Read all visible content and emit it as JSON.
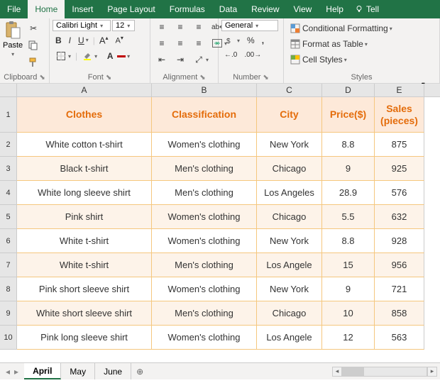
{
  "titlebar": {
    "tabs": [
      "File",
      "Home",
      "Insert",
      "Page Layout",
      "Formulas",
      "Data",
      "Review",
      "View",
      "Help"
    ],
    "active_tab": "Home",
    "tell": "Tell"
  },
  "ribbon": {
    "clipboard": {
      "paste": "Paste",
      "label": "Clipboard"
    },
    "font": {
      "name": "Calibri Light",
      "size": "12",
      "bold": "B",
      "italic": "I",
      "underline": "U",
      "label": "Font"
    },
    "alignment": {
      "wrap": "ab",
      "label": "Alignment"
    },
    "number": {
      "format": "General",
      "percent": "%",
      "comma": ",",
      "dec_inc": ".0",
      "dec_dec": ".00",
      "label": "Number"
    },
    "styles": {
      "cond": "Conditional Formatting",
      "table": "Format as Table",
      "cell": "Cell Styles",
      "label": "Styles"
    }
  },
  "columns": [
    "A",
    "B",
    "C",
    "D",
    "E"
  ],
  "headers": {
    "a": "Clothes",
    "b": "Classification",
    "c": "City",
    "d": "Price($)",
    "e": "Sales (pieces)"
  },
  "rows": [
    {
      "n": "2",
      "a": "White cotton t-shirt",
      "b": "Women's clothing",
      "c": "New York",
      "d": "8.8",
      "e": "875"
    },
    {
      "n": "3",
      "a": "Black t-shirt",
      "b": "Men's clothing",
      "c": "Chicago",
      "d": "9",
      "e": "925"
    },
    {
      "n": "4",
      "a": "White long sleeve shirt",
      "b": "Men's clothing",
      "c": "Los Angeles",
      "d": "28.9",
      "e": "576"
    },
    {
      "n": "5",
      "a": "Pink shirt",
      "b": "Women's clothing",
      "c": "Chicago",
      "d": "5.5",
      "e": "632"
    },
    {
      "n": "6",
      "a": "White t-shirt",
      "b": "Women's clothing",
      "c": "New York",
      "d": "8.8",
      "e": "928"
    },
    {
      "n": "7",
      "a": "White t-shirt",
      "b": "Men's clothing",
      "c": "Los Angele",
      "d": "15",
      "e": "956"
    },
    {
      "n": "8",
      "a": "Pink short sleeve shirt",
      "b": "Women's clothing",
      "c": "New York",
      "d": "9",
      "e": "721"
    },
    {
      "n": "9",
      "a": "White short sleeve shirt",
      "b": "Men's clothing",
      "c": "Chicago",
      "d": "10",
      "e": "858"
    },
    {
      "n": "10",
      "a": "Pink long sleeve shirt",
      "b": "Women's clothing",
      "c": "Los Angele",
      "d": "12",
      "e": "563"
    }
  ],
  "sheets": {
    "tabs": [
      "April",
      "May",
      "June"
    ],
    "active": "April"
  }
}
